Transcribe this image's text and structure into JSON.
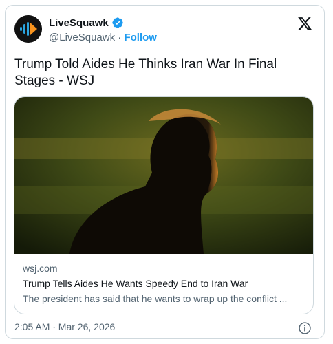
{
  "account": {
    "name": "LiveSquawk",
    "handle": "@LiveSquawk",
    "separator": " · ",
    "follow_label": "Follow",
    "verified": true
  },
  "icons": {
    "avatar": "livesquawk-logo",
    "verified": "verified-badge-icon",
    "platform": "x-logo-icon",
    "info": "info-icon"
  },
  "tweet": {
    "text": "Trump Told Aides He Thinks Iran War In Final Stages - WSJ"
  },
  "link_card": {
    "domain": "wsj.com",
    "headline": "Trump Tells Aides He Wants Speedy End to Iran War",
    "description": "The president has said that he wants to wrap up the conflict ..."
  },
  "footer": {
    "timestamp": "2:05 AM · Mar 26, 2026"
  },
  "colors": {
    "accent": "#1d9bf0",
    "text": "#0f1419",
    "secondary": "#536471",
    "border": "#cfd9de",
    "logo_orange": "#f7931e",
    "logo_blue": "#2aa5e0"
  }
}
